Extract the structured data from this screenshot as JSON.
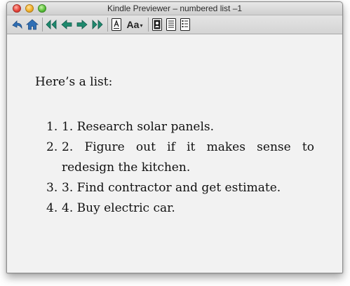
{
  "window": {
    "title": "Kindle Previewer – numbered list –1"
  },
  "toolbar": {
    "buttons": [
      {
        "name": "back",
        "icon": "back-arrow-icon"
      },
      {
        "name": "home",
        "icon": "home-icon"
      },
      {
        "name": "first-page",
        "icon": "double-left-arrow-icon"
      },
      {
        "name": "previous-page",
        "icon": "left-arrow-icon"
      },
      {
        "name": "next-page",
        "icon": "right-arrow-icon"
      },
      {
        "name": "last-page",
        "icon": "double-right-arrow-icon"
      },
      {
        "name": "font-settings",
        "icon": "font-icon"
      },
      {
        "name": "font-size",
        "icon": "text-size-icon",
        "label": "Aa"
      },
      {
        "name": "cover-view",
        "icon": "cover-icon"
      },
      {
        "name": "page-view",
        "icon": "page-icon"
      },
      {
        "name": "toc-view",
        "icon": "toc-icon"
      }
    ]
  },
  "content": {
    "heading": "Here’s a list:",
    "items": [
      {
        "number": "1.",
        "text": "1. Research solar panels."
      },
      {
        "number": "2.",
        "text": "2. Figure out if it makes sense to redesign the kitchen."
      },
      {
        "number": "3.",
        "text": "3. Find contractor and get estimate."
      },
      {
        "number": "4.",
        "text": "4. Buy electric car."
      }
    ]
  },
  "colors": {
    "window_bg": "#ececec",
    "content_bg": "#f2f2f2",
    "icon_blue": "#2f6fb5",
    "icon_green": "#1f8a6e"
  }
}
